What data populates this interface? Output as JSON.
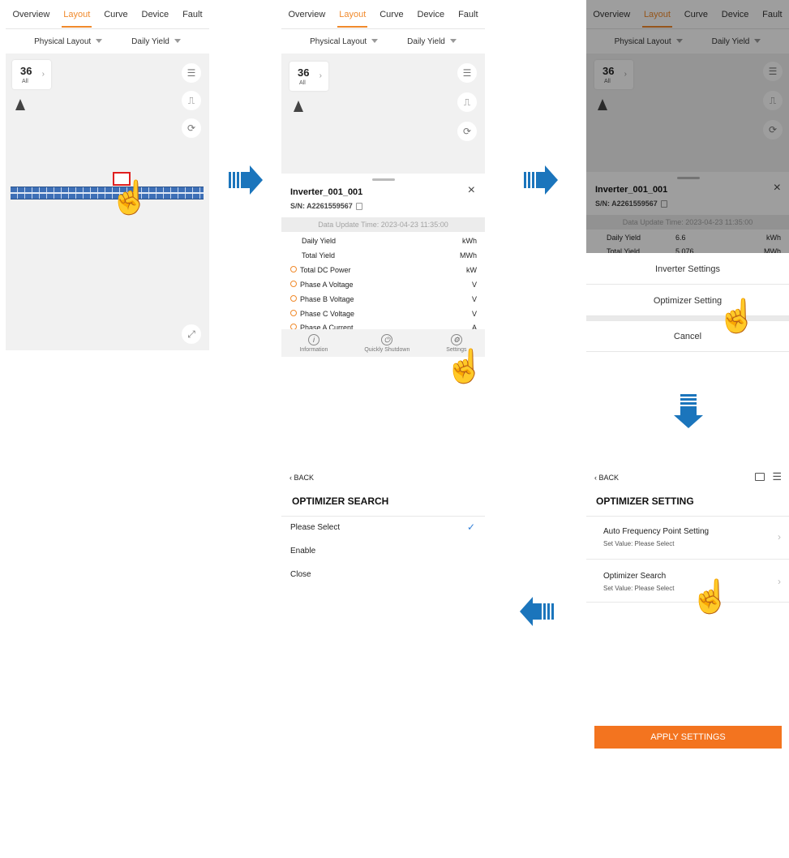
{
  "tabs": [
    "Overview",
    "Layout",
    "Curve",
    "Device",
    "Fault"
  ],
  "selectors": {
    "layout": "Physical Layout",
    "metric": "Daily Yield"
  },
  "device_count": {
    "value": "36",
    "label": "All"
  },
  "inverter": {
    "name": "Inverter_001_001",
    "sn": "S/N: A2261559567",
    "update_time": "Data Update Time: 2023-04-23 11:35:00",
    "rows": [
      {
        "label": "Daily Yield",
        "unit": "kWh"
      },
      {
        "label": "Total Yield",
        "unit": "MWh"
      },
      {
        "label": "Total DC Power",
        "unit": "kW"
      },
      {
        "label": "Phase A Voltage",
        "unit": "V"
      },
      {
        "label": "Phase B Voltage",
        "unit": "V"
      },
      {
        "label": "Phase C Voltage",
        "unit": "V"
      },
      {
        "label": "Phase A Current",
        "unit": "A"
      }
    ],
    "dimmed_rows": [
      {
        "label": "Daily Yield",
        "value": "6.6",
        "unit": "kWh"
      },
      {
        "label": "Total Yield",
        "value": "5.076",
        "unit": "MWh"
      }
    ],
    "bottom_actions": [
      "Information",
      "Quickly Shutdown",
      "Settings"
    ]
  },
  "action_menu": {
    "items": [
      "Inverter Settings",
      "Optimizer Setting"
    ],
    "cancel": "Cancel"
  },
  "optimizer_setting": {
    "back": "BACK",
    "title": "OPTIMIZER SETTING",
    "items": [
      {
        "title": "Auto Frequency Point Setting",
        "sub": "Set Value: Please Select"
      },
      {
        "title": "Optimizer Search",
        "sub": "Set Value: Please Select"
      }
    ],
    "apply": "APPLY SETTINGS"
  },
  "optimizer_search": {
    "back": "BACK",
    "title": "OPTIMIZER SEARCH",
    "options": [
      "Please Select",
      "Enable",
      "Close"
    ],
    "selected_index": 0
  },
  "colors": {
    "accent": "#f08a2c",
    "flow_arrow": "#1b75bc",
    "apply_button": "#f3741f",
    "check": "#2f7ed8"
  }
}
